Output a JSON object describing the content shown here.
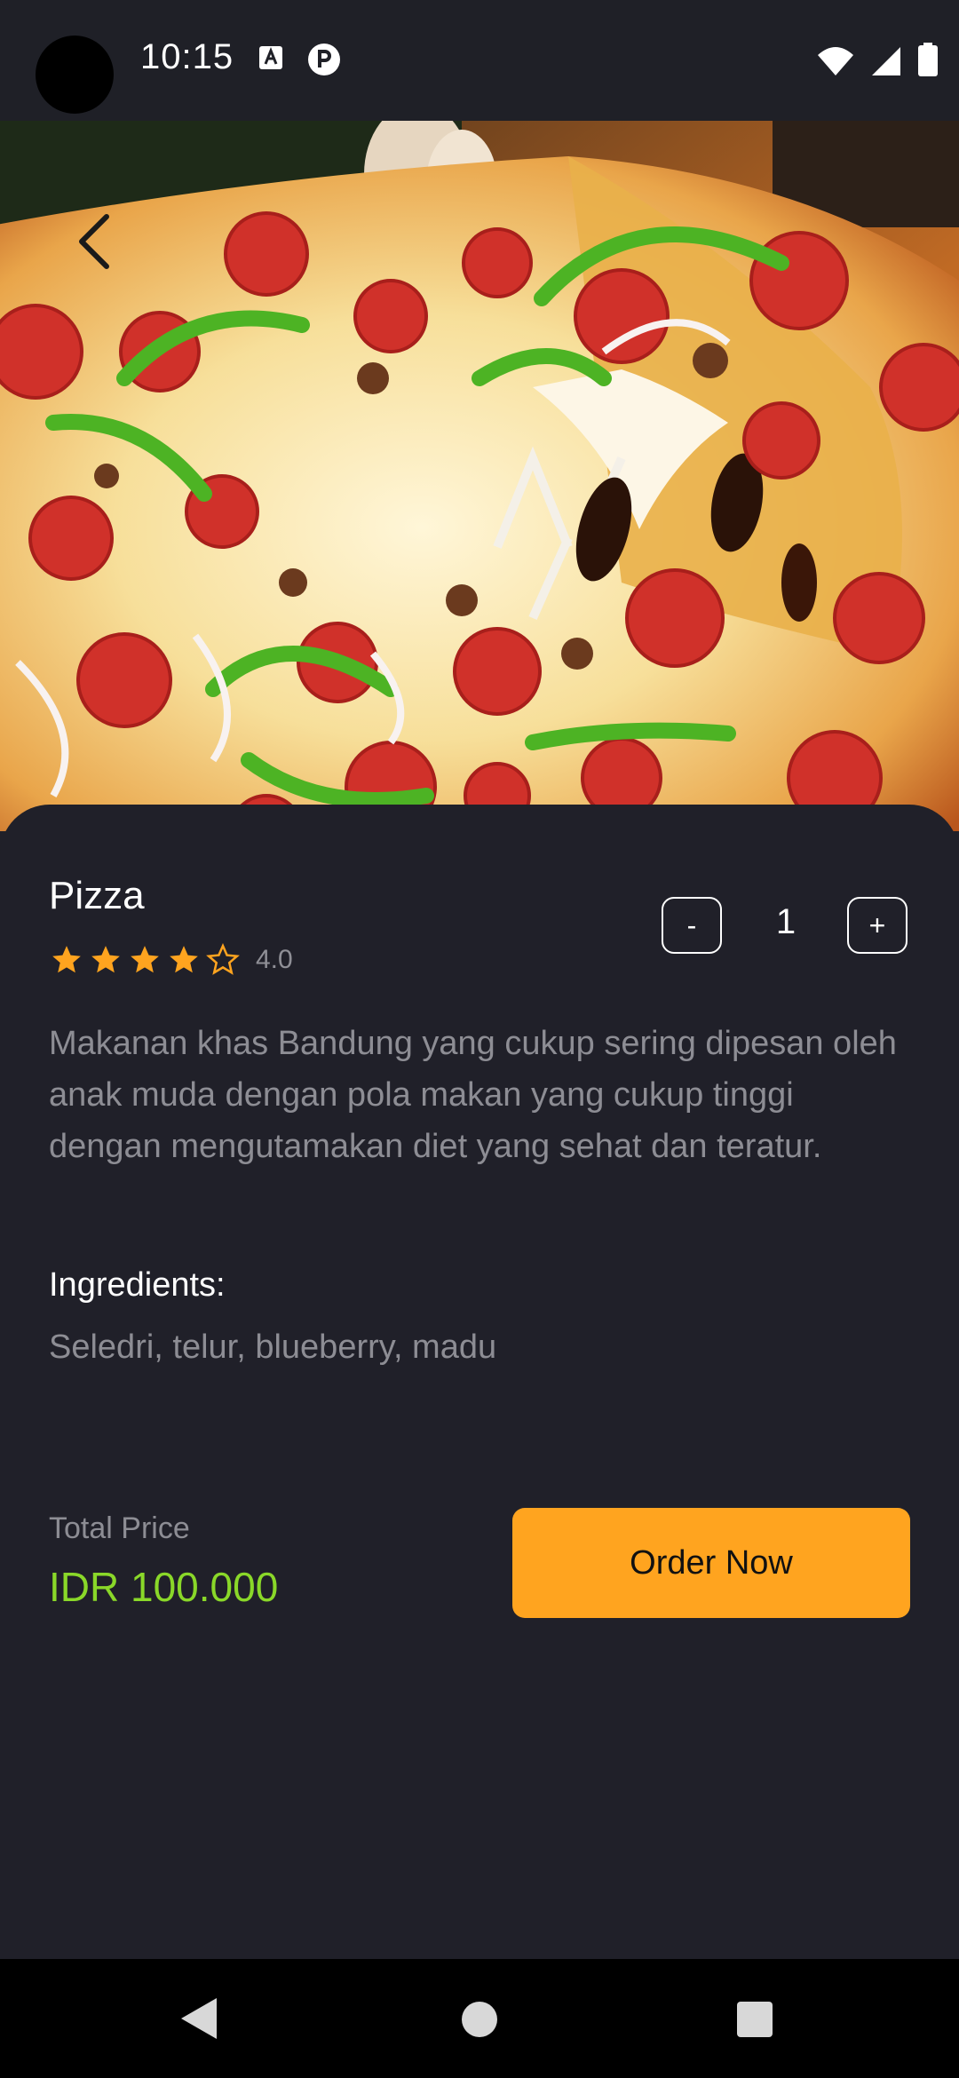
{
  "status_bar": {
    "time": "10:15"
  },
  "product": {
    "name": "Pizza",
    "rating_value": "4.0",
    "rating_stars": 4,
    "description": "Makanan khas Bandung yang cukup sering dipesan oleh anak muda dengan pola makan yang cukup tinggi dengan mengutamakan diet yang sehat dan teratur.",
    "ingredients_title": "Ingredients:",
    "ingredients": "Seledri, telur, blueberry, madu"
  },
  "quantity": {
    "minus_label": "-",
    "value": "1",
    "plus_label": "+"
  },
  "checkout": {
    "total_label": "Total Price",
    "total_value": "IDR 100.000",
    "order_label": "Order Now"
  },
  "colors": {
    "background": "#202029",
    "accent_orange": "#ffa41f",
    "price_green": "#8ad829",
    "star": "#ffa41f",
    "muted_text": "#8d8d94"
  },
  "icons": {
    "back": "chevron-left-icon",
    "star": "star-icon",
    "star_empty": "star-outline-icon",
    "wifi": "wifi-icon",
    "signal": "signal-icon",
    "battery": "battery-icon",
    "nav_back": "triangle-back-icon",
    "nav_home": "circle-home-icon",
    "nav_recent": "square-recent-icon"
  }
}
